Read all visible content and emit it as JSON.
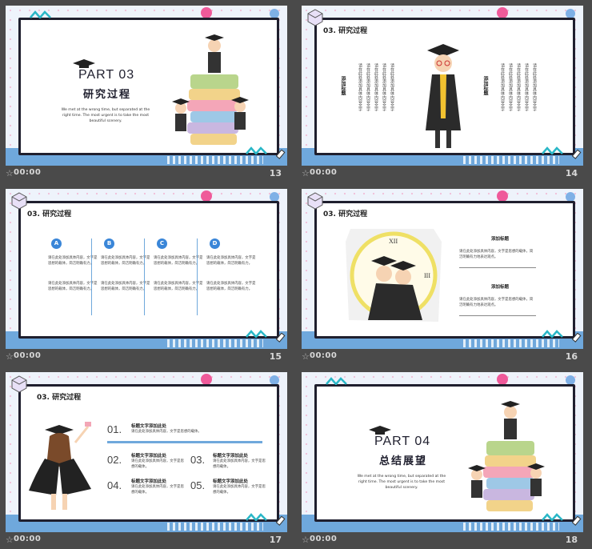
{
  "slides": [
    {
      "number": "13",
      "time": "00:00",
      "part": "PART 03",
      "title": "研究过程",
      "subtitle": "We met at the wrong time, but separated at the right time. The most urgent is to take the most beautiful scenery."
    },
    {
      "number": "14",
      "time": "00:00",
      "header": "03. 研究过程",
      "col_title_left": "添加标题",
      "col_title_right": "添加标题",
      "col_text": "请在此处添加具体内容文字"
    },
    {
      "number": "15",
      "time": "00:00",
      "header": "03. 研究过程",
      "items": [
        {
          "letter": "A",
          "text1": "请在此处添加具体内容，文字是思想的载体，简洁明确有力。",
          "text2": "请在此处添加具体内容，文字是思想的载体，简洁明确有力。"
        },
        {
          "letter": "B",
          "text1": "请在此处添加具体内容，文字是思想的载体，简洁明确有力。",
          "text2": "请在此处添加具体内容，文字是思想的载体，简洁明确有力。"
        },
        {
          "letter": "C",
          "text1": "请在此处添加具体内容，文字是思想的载体，简洁明确有力。",
          "text2": "请在此处添加具体内容，文字是思想的载体，简洁明确有力。"
        },
        {
          "letter": "D",
          "text1": "请在此处添加具体内容，文字是思想的载体，简洁明确有力。",
          "text2": "请在此处添加具体内容，文字是思想的载体，简洁明确有力。"
        }
      ]
    },
    {
      "number": "16",
      "time": "00:00",
      "header": "03. 研究过程",
      "label1": "添加标题",
      "text1": "请在此处添加具体内容，文字是思想的载体，简洁明确有力地表达观点。",
      "label2": "添加标题",
      "text2": "请在此处添加具体内容，文字是思想的载体，简洁明确有力地表达观点。"
    },
    {
      "number": "17",
      "time": "00:00",
      "header": "03. 研究过程",
      "items": [
        {
          "num": "01.",
          "title": "标题文字添加此处",
          "text": "请在此处添加具体内容，文字是思想的载体。"
        },
        {
          "num": "02.",
          "title": "标题文字添加此处",
          "text": "请在此处添加具体内容，文字是思想的载体。"
        },
        {
          "num": "03.",
          "title": "标题文字添加此处",
          "text": "请在此处添加具体内容，文字是思想的载体。"
        },
        {
          "num": "04.",
          "title": "标题文字添加此处",
          "text": "请在此处添加具体内容，文字是思想的载体。"
        },
        {
          "num": "05.",
          "title": "标题文字添加此处",
          "text": "请在此处添加具体内容，文字是思想的载体。"
        }
      ]
    },
    {
      "number": "18",
      "time": "00:00",
      "part": "PART 04",
      "title": "总结展望",
      "subtitle": "We met at the wrong time, but separated at the right time. The most urgent is to take the most beautiful scenery."
    }
  ],
  "colors": {
    "accent": "#6fa8dc",
    "pink": "#ef5a9a",
    "frame": "#1f1f2e",
    "panel": "#4a4a4a"
  }
}
